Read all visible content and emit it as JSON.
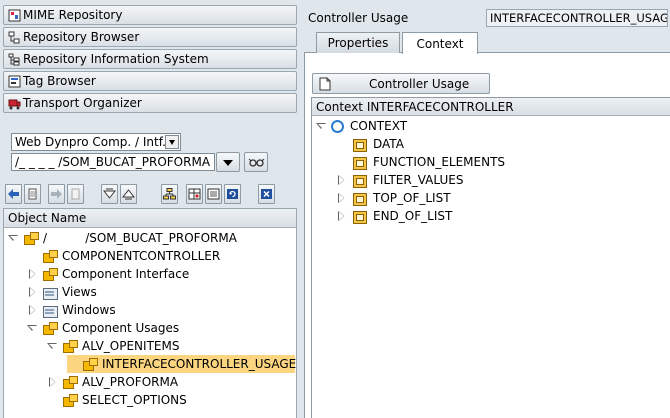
{
  "left_nav": {
    "buttons": [
      {
        "label": "MIME Repository",
        "icon": "mime-repository-icon"
      },
      {
        "label": "Repository Browser",
        "icon": "repository-browser-icon"
      },
      {
        "label": "Repository Information System",
        "icon": "repository-info-system-icon"
      },
      {
        "label": "Tag Browser",
        "icon": "tag-browser-icon"
      },
      {
        "label": "Transport Organizer",
        "icon": "transport-organizer-icon"
      }
    ]
  },
  "object_selector": {
    "type_value": "Web Dynpro Comp. / Intf.",
    "name_value": "/_ _ _ _ /SOM_BUCAT_PROFORMA"
  },
  "object_tree": {
    "header": "Object Name",
    "nodes": [
      {
        "label": "/          /SOM_BUCAT_PROFORMA",
        "toggle": "down",
        "icon": "component-icon"
      },
      {
        "label": "COMPONENTCONTROLLER",
        "toggle": "none",
        "icon": "controller-icon"
      },
      {
        "label": "Component Interface",
        "toggle": "right",
        "icon": "component-interface-icon"
      },
      {
        "label": "Views",
        "toggle": "right",
        "icon": "folder-icon"
      },
      {
        "label": "Windows",
        "toggle": "right",
        "icon": "folder-icon"
      },
      {
        "label": "Component Usages",
        "toggle": "down",
        "icon": "component-usage-icon"
      },
      {
        "label": "ALV_OPENITEMS",
        "toggle": "down",
        "icon": "component-usage-icon"
      },
      {
        "label": "INTERFACECONTROLLER_USAGE",
        "toggle": "none",
        "icon": "interface-controller-usage-icon",
        "selected": true
      },
      {
        "label": "ALV_PROFORMA",
        "toggle": "right",
        "icon": "component-usage-icon"
      },
      {
        "label": "SELECT_OPTIONS",
        "toggle": "none",
        "icon": "component-usage-icon"
      }
    ]
  },
  "right": {
    "title_label": "Controller Usage",
    "title_value": "INTERFACECONTROLLER_USAGE",
    "tabs": [
      {
        "label": "Properties",
        "active": false
      },
      {
        "label": "Context",
        "active": true
      }
    ],
    "controller_usage_button": "Controller Usage",
    "context_tree": {
      "header": "Context INTERFACECONTROLLER",
      "root": "CONTEXT",
      "nodes": [
        {
          "label": "DATA",
          "toggle": "none"
        },
        {
          "label": "FUNCTION_ELEMENTS",
          "toggle": "none"
        },
        {
          "label": "FILTER_VALUES",
          "toggle": "right"
        },
        {
          "label": "TOP_OF_LIST",
          "toggle": "right"
        },
        {
          "label": "END_OF_LIST",
          "toggle": "right"
        }
      ]
    }
  },
  "colors": {
    "background": "#dfe6ec",
    "selection": "#fcd580",
    "accent_blue": "#2a7ad0"
  }
}
